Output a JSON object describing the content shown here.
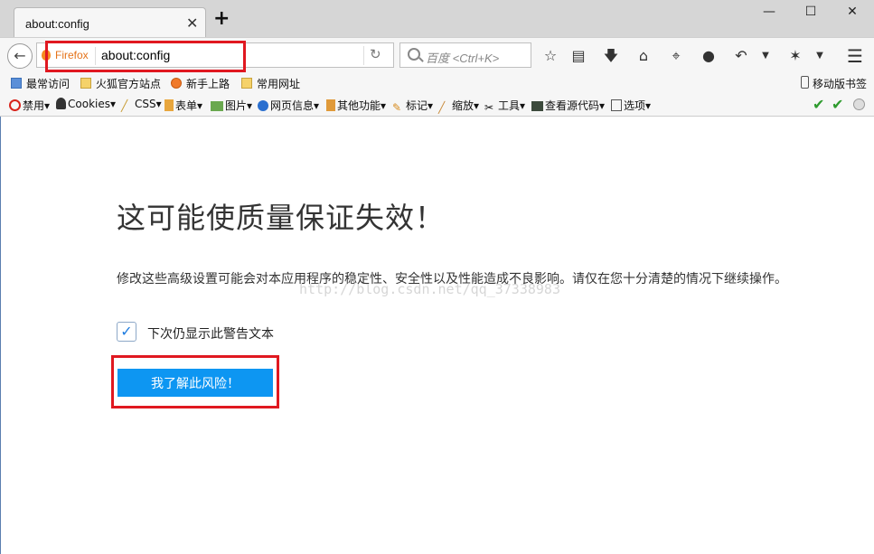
{
  "window": {
    "controls": [
      "—",
      "☐",
      "✕"
    ]
  },
  "tab": {
    "title": "about:config",
    "close": "✕",
    "new_tab": "+"
  },
  "navbar": {
    "identity_label": "Firefox",
    "url": "about:config",
    "search_placeholder": "百度 <Ctrl+K>",
    "icons": [
      "back-icon",
      "reload-icon",
      "star-icon",
      "reader-icon",
      "download-icon",
      "home-icon",
      "crop-icon",
      "chat-icon",
      "undo-icon",
      "dropdown-icon",
      "bug-icon",
      "dropdown-icon",
      "menu-icon"
    ]
  },
  "bookmarks": {
    "items": [
      "最常访问",
      "火狐官方站点",
      "新手上路",
      "常用网址"
    ],
    "mobile": "移动版书签"
  },
  "devbar": {
    "items": [
      "禁用",
      "Cookies",
      "CSS",
      "表单",
      "图片",
      "网页信息",
      "其他功能",
      "标记",
      "缩放",
      "工具",
      "查看源代码",
      "选项"
    ]
  },
  "content": {
    "title": "这可能使质量保证失效！",
    "description": "修改这些高级设置可能会对本应用程序的稳定性、安全性以及性能造成不良影响。请仅在您十分清楚的情况下继续操作。",
    "checkbox_label": "下次仍显示此警告文本",
    "checkbox_checked": true,
    "accept_button": "我了解此风险！",
    "watermark": "http://blog.csdn.net/qq_37338983"
  },
  "colors": {
    "accent": "#0d96f2",
    "highlight": "#e01820",
    "check": "#1f7ce0"
  }
}
